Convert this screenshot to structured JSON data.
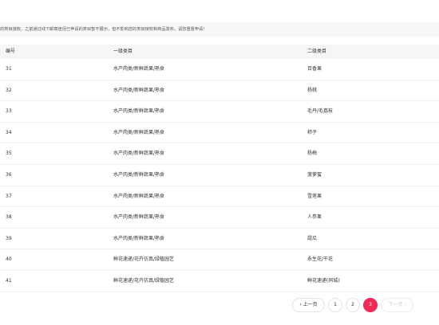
{
  "notice": {
    "text": "的类目授权。之前通过线下邮寄途径已申请的类目暂不展示，但不影响您的类目授权和商品发布，请您重置申请!"
  },
  "table": {
    "headers": [
      "编号",
      "一级类目",
      "二级类目"
    ],
    "rows": [
      {
        "id": "31",
        "cat1": "水产肉类/新鲜蔬果/熟食",
        "cat2": "百香果"
      },
      {
        "id": "32",
        "cat1": "水产肉类/新鲜蔬果/熟食",
        "cat2": "杨桃"
      },
      {
        "id": "33",
        "cat1": "水产肉类/新鲜蔬果/熟食",
        "cat2": "毛丹/毛荔枝"
      },
      {
        "id": "34",
        "cat1": "水产肉类/新鲜蔬果/熟食",
        "cat2": "柿子"
      },
      {
        "id": "35",
        "cat1": "水产肉类/新鲜蔬果/熟食",
        "cat2": "杨梅"
      },
      {
        "id": "36",
        "cat1": "水产肉类/新鲜蔬果/熟食",
        "cat2": "菠萝蜜"
      },
      {
        "id": "37",
        "cat1": "水产肉类/新鲜蔬果/熟食",
        "cat2": "雪莲果"
      },
      {
        "id": "38",
        "cat1": "水产肉类/新鲜蔬果/熟食",
        "cat2": "人参果"
      },
      {
        "id": "39",
        "cat1": "水产肉类/新鲜蔬果/熟食",
        "cat2": "甜瓜"
      },
      {
        "id": "40",
        "cat1": "鲜花速递/花卉仿真/绿植园艺",
        "cat2": "永生花/干花"
      },
      {
        "id": "41",
        "cat1": "鲜花速递/花卉仿真/绿植园艺",
        "cat2": "鲜花速递(同城)"
      }
    ]
  },
  "pagination": {
    "prev_label": "‹ 上一页",
    "pages": [
      "1",
      "2",
      "3"
    ],
    "current": "3",
    "next_label": "下一页 ›",
    "accent_color": "#ee2a55"
  }
}
